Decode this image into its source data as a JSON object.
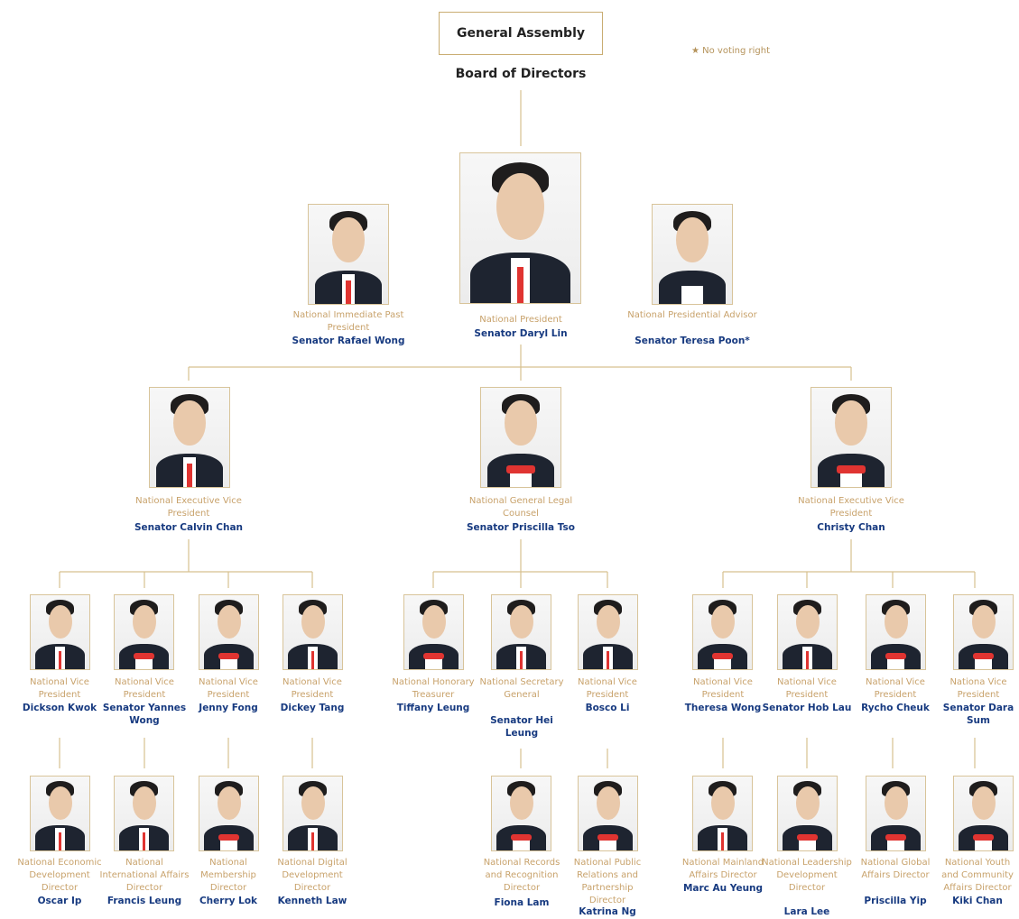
{
  "header": {
    "general_assembly": "General Assembly",
    "board_of_directors": "Board of Directors",
    "note": "★ No voting right"
  },
  "top": {
    "immediate_past_president": {
      "title": "National Immediate Past President",
      "name": "Senator Rafael Wong"
    },
    "national_president": {
      "title": "National President",
      "name": "Senator Daryl Lin"
    },
    "presidential_advisor": {
      "title": "National Presidential Advisor",
      "name": "Senator Teresa Poon*"
    }
  },
  "branches": [
    {
      "title": "National Executive Vice President",
      "name": "Senator Calvin Chan"
    },
    {
      "title": "National General Legal Counsel",
      "name": "Senator Priscilla Tso"
    },
    {
      "title": "National Executive Vice President",
      "name": "Christy Chan"
    }
  ],
  "level3": [
    {
      "title": "National Vice President",
      "name": "Dickson Kwok"
    },
    {
      "title": "National Vice President",
      "name": "Senator Yannes Wong"
    },
    {
      "title": "National Vice President",
      "name": "Jenny Fong"
    },
    {
      "title": "National Vice President",
      "name": "Dickey Tang"
    },
    {
      "title": "National Honorary Treasurer",
      "name": "Tiffany Leung"
    },
    {
      "title": "National Secretary General",
      "name": "Senator Hei Leung"
    },
    {
      "title": "National Vice President",
      "name": "Bosco Li"
    },
    {
      "title": "National Vice President",
      "name": "Theresa Wong"
    },
    {
      "title": "National Vice President",
      "name": "Senator Hob Lau"
    },
    {
      "title": "National Vice President",
      "name": "Rycho Cheuk"
    },
    {
      "title": "Nationa Vice President",
      "name": "Senator Dara Sum"
    }
  ],
  "level4": [
    {
      "title": "National Economic Development Director",
      "name": "Oscar Ip"
    },
    {
      "title": "National International Affairs Director",
      "name": "Francis Leung"
    },
    {
      "title": "National Membership Director",
      "name": "Cherry Lok"
    },
    {
      "title": "National Digital Development Director",
      "name": "Kenneth Law"
    },
    {
      "title": "National Records and Recognition Director",
      "name": "Fiona Lam"
    },
    {
      "title": "National Public Relations and Partnership Director",
      "name": "Katrina Ng"
    },
    {
      "title": "National Mainland Affairs Director",
      "name": "Marc Au Yeung"
    },
    {
      "title": "National Leadership Development Director",
      "name": "Lara Lee"
    },
    {
      "title": "National Global Affairs Director",
      "name": "Priscilla Yip"
    },
    {
      "title": "National Youth and Community Affairs Director",
      "name": "Kiki Chan"
    }
  ]
}
